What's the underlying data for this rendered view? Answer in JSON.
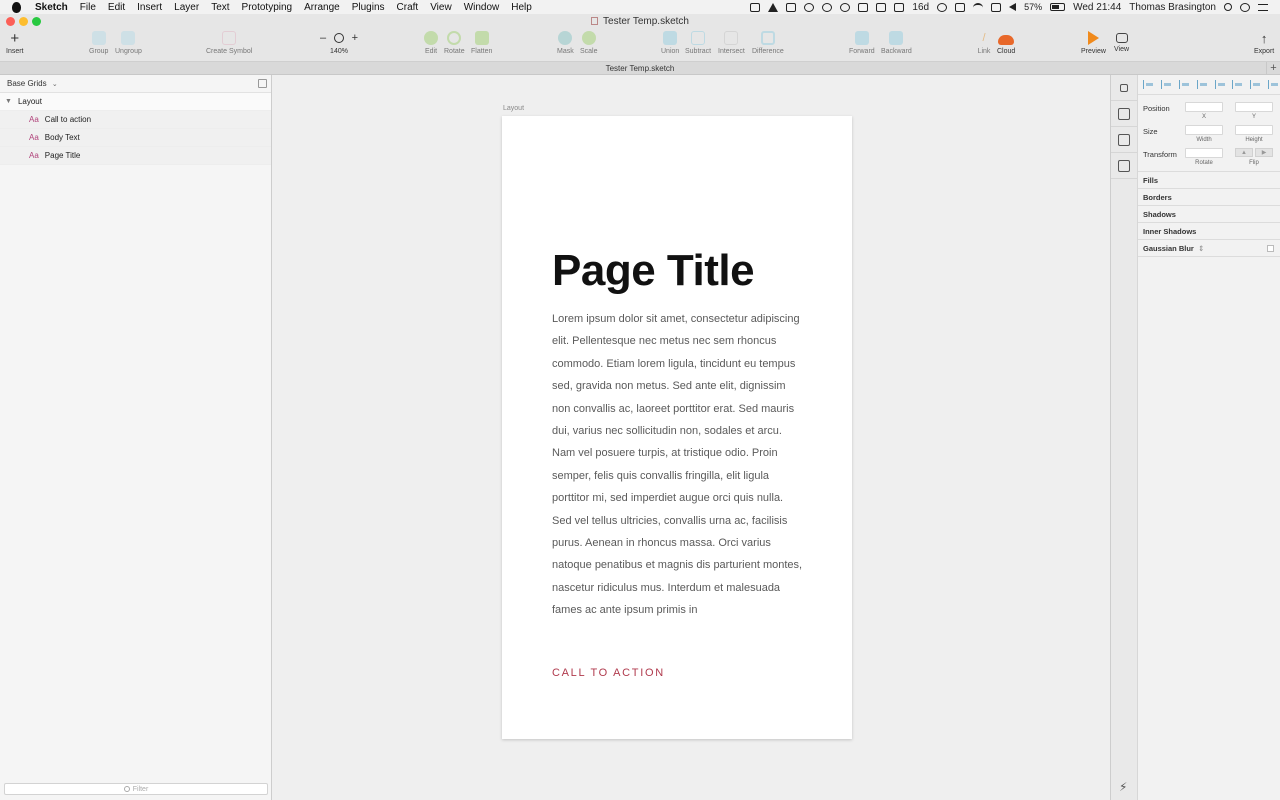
{
  "menubar": {
    "app_name": "Sketch",
    "menus": [
      "File",
      "Edit",
      "Insert",
      "Layer",
      "Text",
      "Prototyping",
      "Arrange",
      "Plugins",
      "Craft",
      "View",
      "Window",
      "Help"
    ],
    "status": {
      "days": "16d",
      "battery": "57%",
      "clock": "Wed 21:44",
      "user": "Thomas Brasington"
    }
  },
  "window": {
    "title": "Tester Temp.sketch",
    "tab_title": "Tester Temp.sketch",
    "tab_plus": "+"
  },
  "toolbar": {
    "insert": "Insert",
    "group": "Group",
    "ungroup": "Ungroup",
    "create_symbol": "Create Symbol",
    "zoom_minus": "–",
    "zoom_plus": "+",
    "zoom_level": "140%",
    "edit": "Edit",
    "rotate": "Rotate",
    "flatten": "Flatten",
    "mask": "Mask",
    "scale": "Scale",
    "union": "Union",
    "subtract": "Subtract",
    "intersect": "Intersect",
    "difference": "Difference",
    "forward": "Forward",
    "backward": "Backward",
    "link": "Link",
    "cloud": "Cloud",
    "preview": "Preview",
    "view": "View",
    "export": "Export"
  },
  "layers": {
    "page_name": "Base Grids",
    "group_name": "Layout",
    "text_prefix": "Aa",
    "items": [
      "Call to action",
      "Body Text",
      "Page Title"
    ],
    "filter_placeholder": "Filter"
  },
  "canvas": {
    "artboard_name": "Layout",
    "page_title": "Page Title",
    "body_text": "Lorem ipsum dolor sit amet, consectetur adipiscing elit. Pellentesque nec metus nec sem rhoncus commodo. Etiam lorem ligula, tincidunt eu tempus sed, gravida non metus. Sed ante elit, dignissim non convallis ac, laoreet porttitor erat. Sed mauris dui, varius nec sollicitudin non, sodales et arcu. Nam vel posuere turpis, at tristique odio. Proin semper, felis quis convallis fringilla, elit ligula porttitor mi, sed imperdiet augue orci quis nulla. Sed vel tellus ultricies, convallis urna ac, facilisis purus. Aenean in rhoncus massa. Orci varius natoque penatibus et magnis dis parturient montes, nascetur ridiculus mus. Interdum et malesuada fames ac ante ipsum primis in",
    "cta": "CALL TO ACTION"
  },
  "inspector": {
    "position": "Position",
    "x": "X",
    "y": "Y",
    "size": "Size",
    "width": "Width",
    "height": "Height",
    "transform": "Transform",
    "rotate": "Rotate",
    "flip": "Flip",
    "sections": [
      "Fills",
      "Borders",
      "Shadows",
      "Inner Shadows"
    ],
    "blur": "Gaussian Blur",
    "blur_arrows": "⇕"
  },
  "colors": {
    "accent_cta": "#b03a4d",
    "layer_text_icon": "#b0427a",
    "preview_orange": "#f08a1c",
    "cloud_orange": "#e8682a"
  }
}
